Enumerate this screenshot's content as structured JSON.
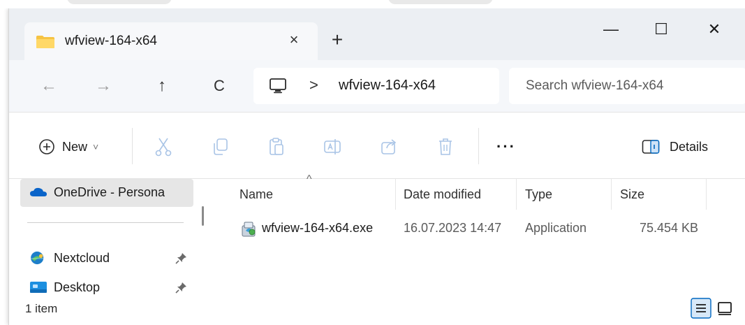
{
  "tab": {
    "title": "wfview-164-x64",
    "close_glyph": "×",
    "new_tab_glyph": "+"
  },
  "window_controls": {
    "minimize": "—",
    "maximize": "☐",
    "close": "✕"
  },
  "nav": {
    "back": "←",
    "forward": "→",
    "up": "↑",
    "refresh": "C"
  },
  "address": {
    "separator": ">",
    "path": "wfview-164-x64"
  },
  "search": {
    "placeholder": "Search wfview-164-x64"
  },
  "command_bar": {
    "new_label": "New",
    "new_chevron": "˅",
    "more": "···",
    "details_label": "Details"
  },
  "sidebar": {
    "items": [
      {
        "label": "OneDrive - Persona",
        "icon": "cloud-icon",
        "selected": true
      },
      {
        "label": "Nextcloud",
        "icon": "nextcloud-icon",
        "pinned": true
      },
      {
        "label": "Desktop",
        "icon": "desktop-icon",
        "pinned": true
      }
    ]
  },
  "file_list": {
    "sort_caret": "^",
    "columns": [
      "Name",
      "Date modified",
      "Type",
      "Size"
    ],
    "rows": [
      {
        "name": "wfview-164-x64.exe",
        "date_modified": "16.07.2023 14:47",
        "type": "Application",
        "size": "75.454 KB",
        "icon": "installer-icon"
      }
    ]
  },
  "status": {
    "item_count": "1 item"
  },
  "colors": {
    "accent": "#0067c0",
    "folder": "#f6c343",
    "frame": "#eceff3"
  }
}
